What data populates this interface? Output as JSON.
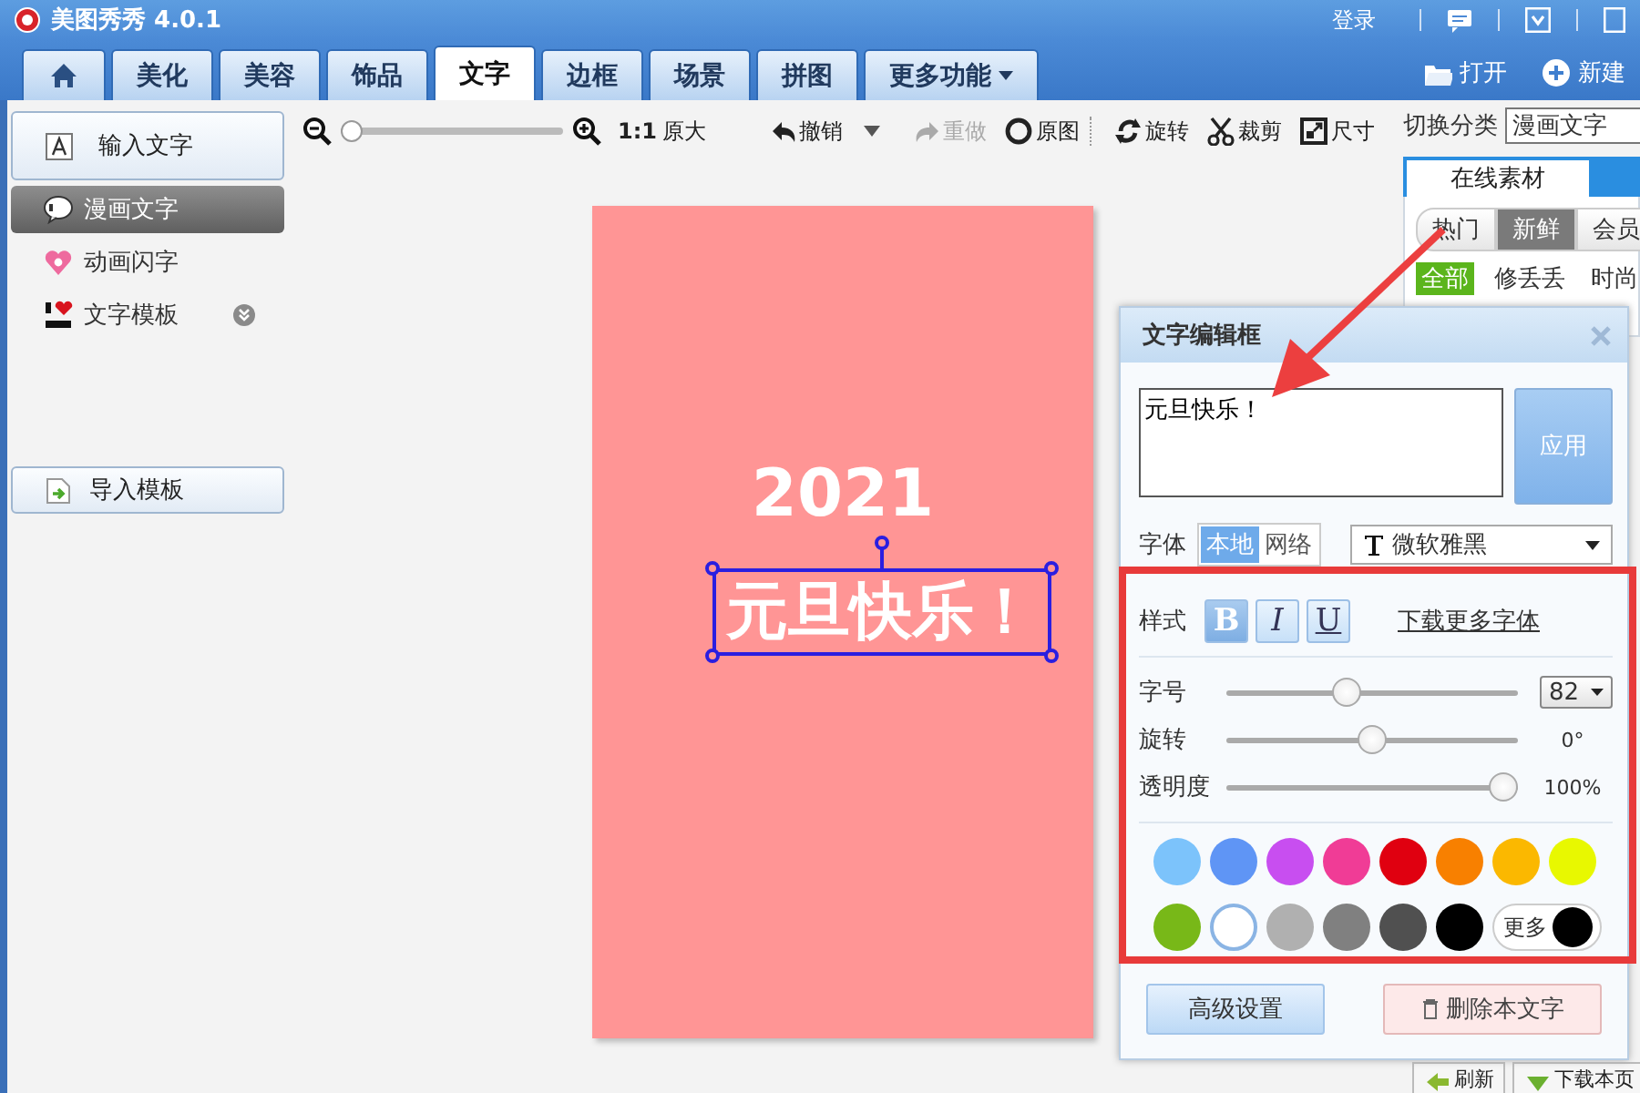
{
  "window": {
    "title": "美图秀秀 4.0.1",
    "login": "登录"
  },
  "tabs": [
    {
      "kind": "home",
      "selected": false
    },
    {
      "kind": "text",
      "label": "美化",
      "selected": false
    },
    {
      "kind": "text",
      "label": "美容",
      "selected": false
    },
    {
      "kind": "text",
      "label": "饰品",
      "selected": false
    },
    {
      "kind": "text",
      "label": "文字",
      "selected": true
    },
    {
      "kind": "text",
      "label": "边框",
      "selected": false
    },
    {
      "kind": "text",
      "label": "场景",
      "selected": false
    },
    {
      "kind": "text",
      "label": "拼图",
      "selected": false
    },
    {
      "kind": "menu",
      "label": "更多功能",
      "selected": false
    }
  ],
  "file_actions": [
    {
      "kind": "open",
      "label": "打开"
    },
    {
      "kind": "new",
      "label": "新建"
    }
  ],
  "left_panel": {
    "input_button": "输入文字",
    "items": [
      {
        "label": "漫画文字",
        "kind": "comic",
        "selected": true,
        "expandable": false
      },
      {
        "label": "动画闪字",
        "kind": "flash",
        "selected": false,
        "expandable": false
      },
      {
        "label": "文字模板",
        "kind": "template",
        "selected": false,
        "expandable": true
      }
    ],
    "import_button": "导入模板"
  },
  "toolbar": {
    "zoom": {
      "level": 0
    },
    "ratio": "1:1",
    "actual_size": "原大",
    "actions": [
      {
        "kind": "undo",
        "label": "撤销",
        "disabled": false,
        "dropdown": true
      },
      {
        "kind": "redo",
        "label": "重做",
        "disabled": true,
        "dropdown": false
      },
      {
        "kind": "original",
        "label": "原图",
        "disabled": false,
        "dropdown": false
      },
      {
        "kind": "rotate",
        "label": "旋转",
        "disabled": false,
        "dropdown": false
      },
      {
        "kind": "crop",
        "label": "裁剪",
        "disabled": false,
        "dropdown": false
      },
      {
        "kind": "resize",
        "label": "尺寸",
        "disabled": false,
        "dropdown": false
      }
    ]
  },
  "canvas": {
    "texts": [
      {
        "text": "2021",
        "selected": false
      },
      {
        "text": "元旦快乐！",
        "selected": true
      }
    ]
  },
  "right_panel": {
    "category_label": "切换分类",
    "category": "漫画文字",
    "tabs": [
      {
        "label": "在线素材",
        "selected": true
      }
    ],
    "filters": [
      {
        "label": "热门",
        "selected": false
      },
      {
        "label": "新鲜",
        "selected": true
      },
      {
        "label": "会员",
        "selected": false
      }
    ],
    "categories": [
      {
        "label": "全部",
        "selected": true
      },
      {
        "label": "修丢丢",
        "selected": false
      },
      {
        "label": "时尚",
        "selected": false
      }
    ],
    "bottom_buttons": [
      {
        "kind": "refresh",
        "label": "刷新"
      },
      {
        "kind": "download",
        "label": "下载本页"
      }
    ]
  },
  "editor": {
    "title": "文字编辑框",
    "text": "元旦快乐！",
    "apply": "应用",
    "font_label": "字体",
    "font_sources": [
      {
        "label": "本地",
        "selected": true
      },
      {
        "label": "网络",
        "selected": false
      }
    ],
    "font": "微软雅黑",
    "style_label": "样式",
    "styles": [
      {
        "kind": "bold",
        "label": "B",
        "selected": true
      },
      {
        "kind": "italic",
        "label": "I",
        "selected": false
      },
      {
        "kind": "underline",
        "label": "U",
        "selected": false
      }
    ],
    "more_fonts": "下载更多字体",
    "sliders": [
      {
        "label": "字号",
        "level": 0.4,
        "kind": "select",
        "reading": "82"
      },
      {
        "label": "旋转",
        "level": 0.5,
        "kind": "reading",
        "reading": "0°"
      },
      {
        "label": "透明度",
        "level": 1,
        "kind": "reading",
        "reading": "100%"
      }
    ],
    "colors": [
      {
        "color": "#7cc3fb",
        "selected": false
      },
      {
        "color": "#5f95f5",
        "selected": false
      },
      {
        "color": "#c84ef0",
        "selected": false
      },
      {
        "color": "#f03c96",
        "selected": false
      },
      {
        "color": "#e00010",
        "selected": false
      },
      {
        "color": "#f88000",
        "selected": false
      },
      {
        "color": "#fbb800",
        "selected": false
      },
      {
        "color": "#e8f800",
        "selected": false
      },
      {
        "color": "#78b818",
        "selected": false
      },
      {
        "color": "#ffffff",
        "selected": true
      },
      {
        "color": "#b0b0b0",
        "selected": false
      },
      {
        "color": "#808080",
        "selected": false
      },
      {
        "color": "#505050",
        "selected": false
      },
      {
        "color": "#000000",
        "selected": false
      }
    ],
    "more_colors": "更多",
    "advanced": "高级设置",
    "delete": "删除本文字"
  },
  "annotation": {
    "highlight": true,
    "arrow": true
  }
}
